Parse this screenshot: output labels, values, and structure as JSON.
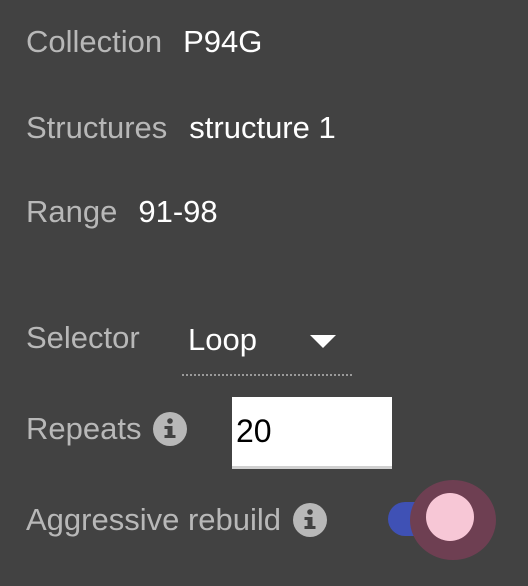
{
  "panel": {
    "collection": {
      "label": "Collection",
      "value": "P94G"
    },
    "structures": {
      "label": "Structures",
      "value": "structure 1"
    },
    "range": {
      "label": "Range",
      "value": "91-98"
    },
    "selector": {
      "label": "Selector",
      "value": "Loop"
    },
    "repeats": {
      "label": "Repeats",
      "value": "20",
      "icon": "info-icon"
    },
    "aggressive_rebuild": {
      "label": "Aggressive rebuild",
      "icon": "info-icon",
      "enabled": true
    }
  },
  "colors": {
    "background": "#424242",
    "label": "#b8b8b8",
    "value": "#ffffff",
    "toggle_track": "#3f51b5",
    "toggle_thumb": "#f7c7d6"
  }
}
